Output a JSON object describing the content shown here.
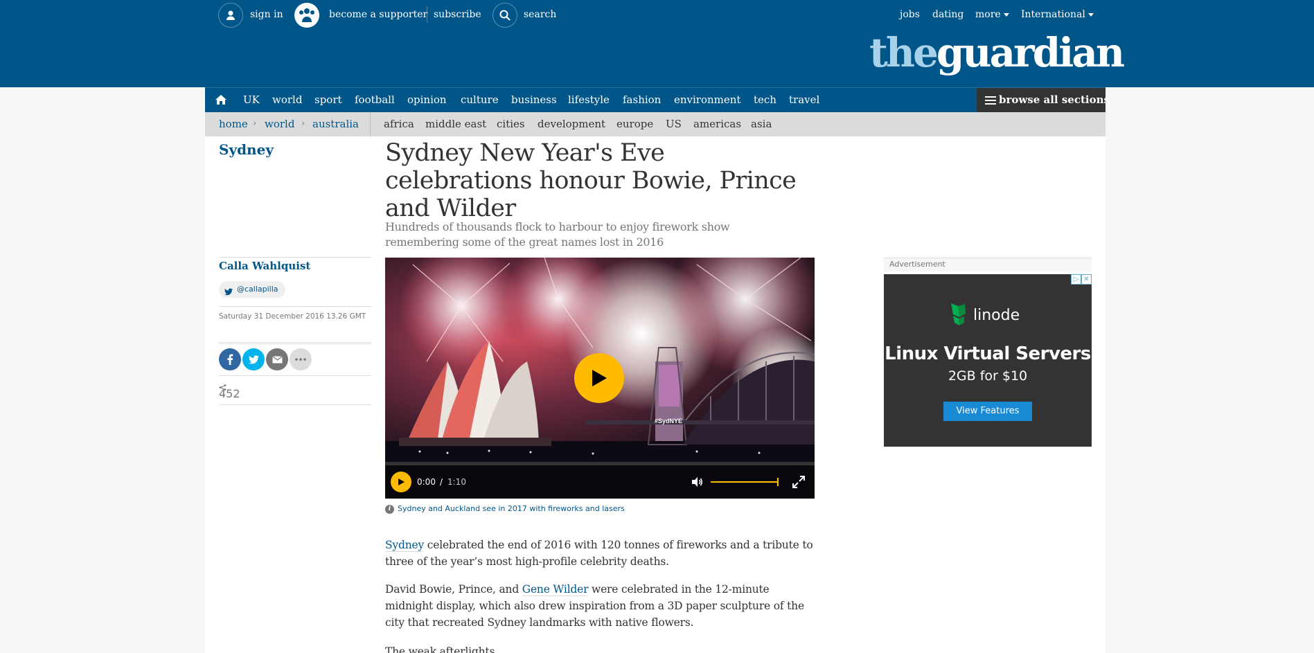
{
  "header": {
    "sign_in": "sign in",
    "become_supporter": "become a supporter",
    "subscribe": "subscribe",
    "search": "search",
    "jobs": "jobs",
    "dating": "dating",
    "more": "more",
    "edition": "International",
    "logo_the": "the",
    "logo_guardian": "guardian"
  },
  "nav": {
    "items": [
      "UK",
      "world",
      "sport",
      "football",
      "opinion",
      "culture",
      "business",
      "lifestyle",
      "fashion",
      "environment",
      "tech",
      "travel"
    ],
    "browse_all": "browse all sections"
  },
  "subnav": {
    "breadcrumbs": [
      "home",
      "world",
      "australia"
    ],
    "items": [
      "africa",
      "middle east",
      "cities",
      "development",
      "europe",
      "US",
      "americas",
      "asia"
    ]
  },
  "article": {
    "section": "Sydney",
    "headline": "Sydney New Year's Eve celebrations honour Bowie, Prince and Wilder",
    "standfirst": "Hundreds of thousands flock to harbour to enjoy firework show remembering some of the great names lost in 2016",
    "byline": "Calla Wahlquist",
    "twitter": "@callapilla",
    "date": "Saturday 31 December 2016 13.26 GMT",
    "share_count": "452",
    "video": {
      "time_current": "0:00",
      "time_sep": "/",
      "duration": "1:10",
      "hashtag": "#SydNYE",
      "progress": 0,
      "volume": 1.0
    },
    "caption": "Sydney and Auckland see in 2017 with fireworks and lasers",
    "para1": {
      "link": "Sydney",
      "text": " celebrated the end of 2016 with 120 tonnes of fireworks and a tribute to three of the year’s most high-profile celebrity deaths."
    },
    "para2": {
      "text_before": "David Bowie, Prince, and ",
      "link": "Gene Wilder",
      "text_after": " were celebrated in the 12-minute midnight display, which also drew inspiration from a 3D paper sculpture of the city that recreated Sydney landmarks with native flowers."
    },
    "para3_partial": "The weak afterlights... "
  },
  "advertisement": {
    "label": "Advertisement",
    "brand": "linode",
    "headline": "Linux Virtual Servers",
    "subline": "2GB for $10",
    "cta": "View Features",
    "adchoices": "▷",
    "close": "✕"
  },
  "colors": {
    "brand_blue": "#005689",
    "light_blue": "#a9d1ea",
    "accent_yellow": "#ffbb00",
    "linode_green": "#00b050"
  }
}
